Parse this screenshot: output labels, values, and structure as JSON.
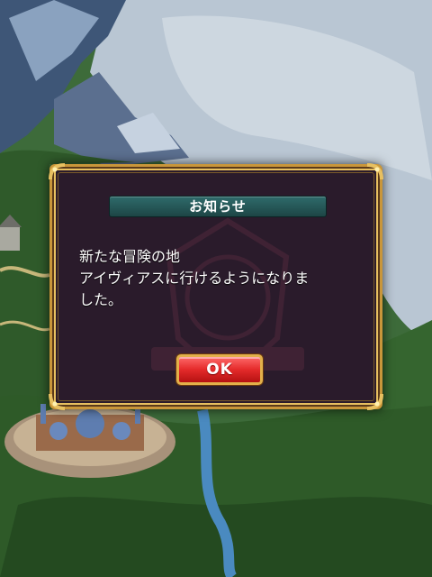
{
  "dialog": {
    "title": "お知らせ",
    "message": "新たな冒険の地\nアイヴィアスに行けるようになりま\nした。",
    "ok_label": "OK"
  },
  "colors": {
    "frame_gold": "#c9963a",
    "panel_bg": "#2a1b2b",
    "title_bar": "#2f6b6b",
    "ok_button": "#e42a2a"
  },
  "icons": [
    "corner-ornament-icon",
    "emblem-icon"
  ]
}
